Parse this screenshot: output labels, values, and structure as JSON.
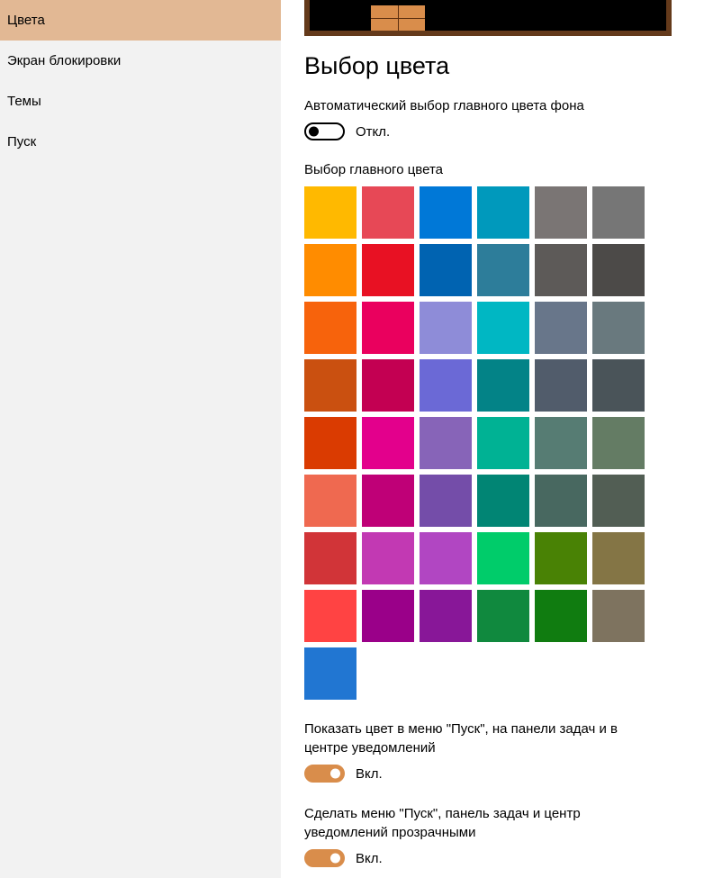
{
  "sidebar": {
    "items": [
      {
        "label": "Цвета",
        "active": true
      },
      {
        "label": "Экран блокировки",
        "active": false
      },
      {
        "label": "Темы",
        "active": false
      },
      {
        "label": "Пуск",
        "active": false
      }
    ]
  },
  "main": {
    "section_title": "Выбор цвета",
    "auto_pick": {
      "label": "Автоматический выбор главного цвета фона",
      "state_label": "Откл.",
      "on": false
    },
    "accent_label": "Выбор главного цвета",
    "swatches": [
      "#ffb900",
      "#e74856",
      "#0078d7",
      "#0099bc",
      "#7a7574",
      "#767676",
      "#ff8c00",
      "#e81123",
      "#0063b1",
      "#2d7d9a",
      "#5d5a58",
      "#4c4a48",
      "#f7630c",
      "#ea005e",
      "#8e8cd8",
      "#00b7c3",
      "#68768a",
      "#69797e",
      "#ca5010",
      "#c30052",
      "#6b69d6",
      "#038387",
      "#515c6b",
      "#4a5459",
      "#da3b01",
      "#e3008c",
      "#8764b8",
      "#00b294",
      "#567c73",
      "#647c64",
      "#ef6950",
      "#bf0077",
      "#744da9",
      "#018574",
      "#486860",
      "#525e54",
      "#d13438",
      "#c239b3",
      "#b146c2",
      "#00cc6a",
      "#498205",
      "#847545",
      "#ff4343",
      "#9a0089",
      "#881798",
      "#10893e",
      "#107c10",
      "#7e735f",
      "#2176d2"
    ],
    "show_color": {
      "label": "Показать цвет в меню \"Пуск\", на панели задач и в центре уведомлений",
      "state_label": "Вкл.",
      "on": true
    },
    "transparency": {
      "label": "Сделать меню \"Пуск\", панель задач и центр уведомлений прозрачными",
      "state_label": "Вкл.",
      "on": true
    }
  }
}
